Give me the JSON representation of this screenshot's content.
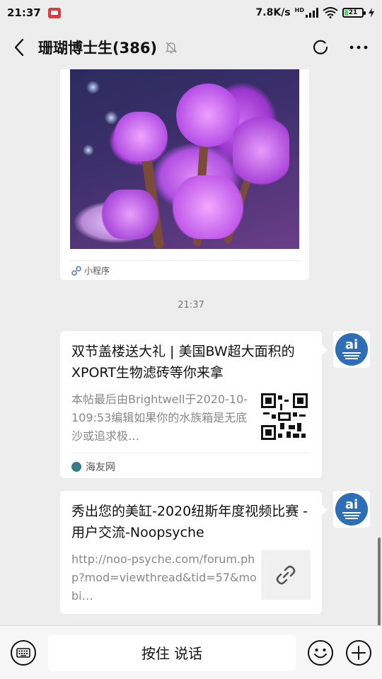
{
  "status_bar": {
    "time": "21:37",
    "network_speed": "7.8K/s",
    "network_type": "HD",
    "battery_level": "21"
  },
  "header": {
    "title": "珊瑚博士生(386)",
    "icons": [
      "back-icon",
      "mute-bell-icon",
      "refresh-icon",
      "more-icon"
    ]
  },
  "messages": {
    "mini_program": {
      "label": "小程序"
    },
    "timestamp": "21:37",
    "link_cards": [
      {
        "title": "双节盖楼送大礼 | 美国BW超大面积的XPORT生物滤砖等你来拿",
        "description": "本帖最后由Brightwell于2020-10-109:53编辑如果你的水族箱是无底沙或追求极…",
        "source": "海友网",
        "thumb_icon": "qr-code-icon"
      },
      {
        "title": "秀出您的美缸-2020纽斯年度视频比赛 - 用户交流-Noopsyche",
        "description": "http://noo-psyche.com/forum.php?mod=viewthread&tid=57&mobi…",
        "thumb_icon": "link-icon"
      }
    ]
  },
  "input_bar": {
    "hold_to_talk_label": "按住 说话",
    "icons": [
      "keyboard-icon",
      "emoji-icon",
      "plus-icon"
    ]
  },
  "colors": {
    "background": "#ededed",
    "card": "#ffffff",
    "avatar_blue": "#2f6db5"
  }
}
